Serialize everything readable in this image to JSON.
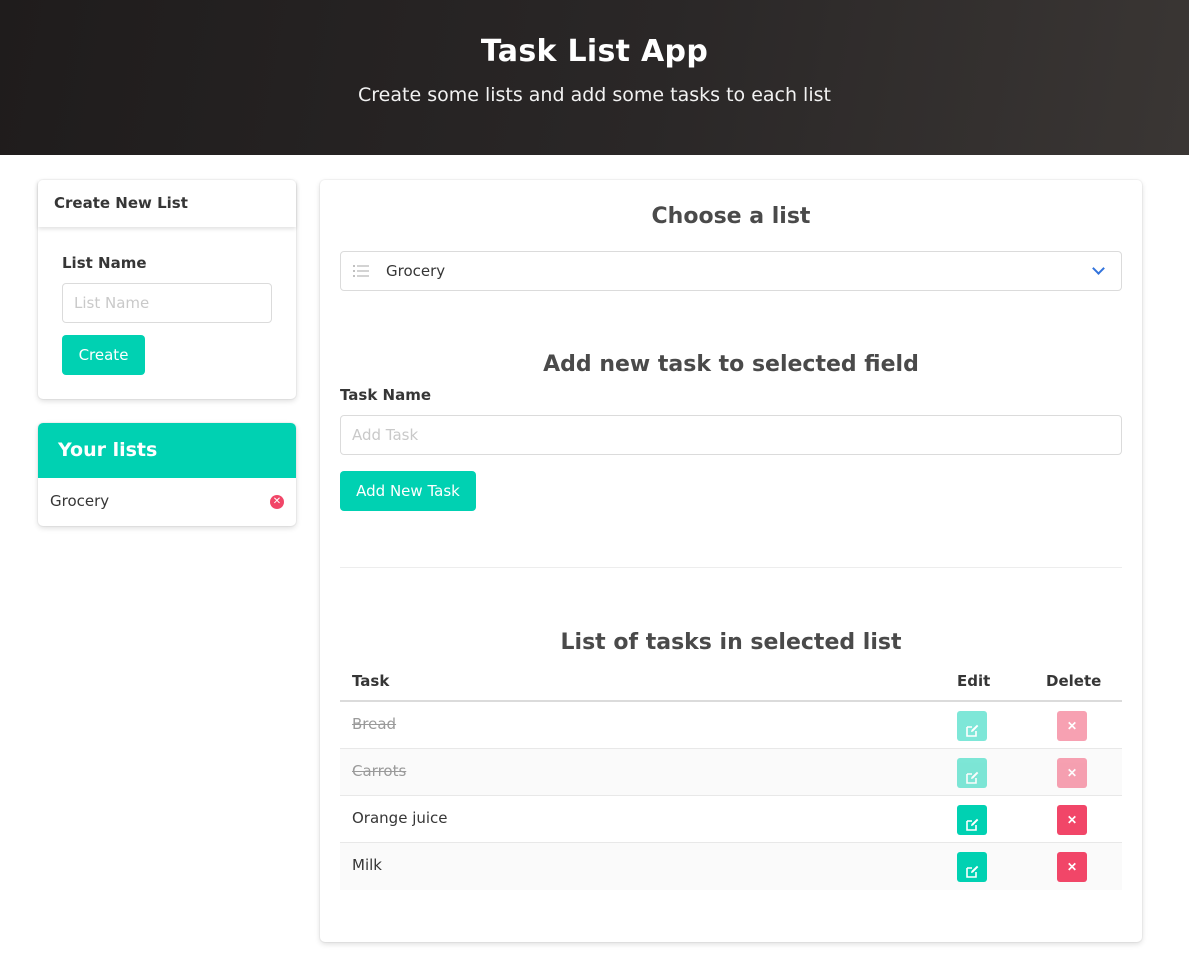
{
  "header": {
    "title": "Task List App",
    "subtitle": "Create some lists and add some tasks to each list"
  },
  "create_list": {
    "title": "Create New List",
    "field_label": "List Name",
    "input_value": "",
    "input_placeholder": "List Name",
    "button_label": "Create"
  },
  "your_lists": {
    "title": "Your lists",
    "items": [
      {
        "name": "Grocery"
      }
    ]
  },
  "main": {
    "choose_title": "Choose a list",
    "selected_list": "Grocery",
    "add_task_title": "Add new task to selected field",
    "task_field_label": "Task Name",
    "task_input_value": "",
    "task_input_placeholder": "Add Task",
    "add_button_label": "Add New Task",
    "tasks_title": "List of tasks in selected list",
    "table": {
      "headers": {
        "task": "Task",
        "edit": "Edit",
        "delete": "Delete"
      },
      "rows": [
        {
          "task": "Bread",
          "done": true
        },
        {
          "task": "Carrots",
          "done": true
        },
        {
          "task": "Orange juice",
          "done": false
        },
        {
          "task": "Milk",
          "done": false
        }
      ]
    }
  },
  "colors": {
    "primary": "#00d1b2",
    "danger": "#f14668",
    "link": "#3273dc",
    "hero_dark": "#1f1c1c"
  },
  "icons": {
    "select_icon": "list-icon",
    "select_arrow": "chevron-down-icon",
    "remove_list": "close-circle-icon",
    "edit": "edit-icon",
    "delete": "close-icon"
  }
}
